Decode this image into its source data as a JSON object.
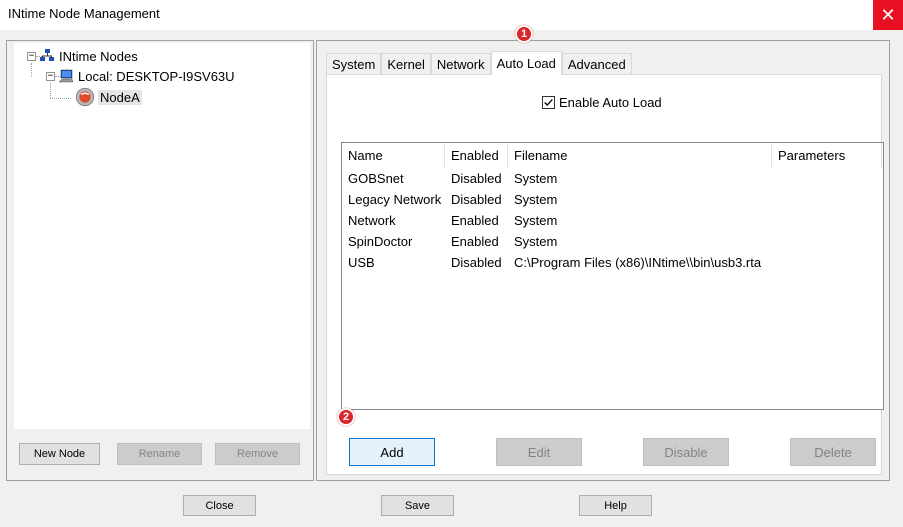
{
  "window": {
    "title": "INtime Node Management",
    "close_glyph": "✕"
  },
  "tree": {
    "root": "INtime Nodes",
    "local": "Local: DESKTOP-I9SV63U",
    "node": "NodeA"
  },
  "left_buttons": {
    "new_node": "New Node",
    "rename": "Rename",
    "remove": "Remove"
  },
  "tabs": [
    "System",
    "Kernel",
    "Network",
    "Auto Load",
    "Advanced"
  ],
  "active_tab": "Auto Load",
  "auto_load": {
    "enable_label": "Enable Auto Load",
    "enabled": true,
    "columns": [
      "Name",
      "Enabled",
      "Filename",
      "Parameters"
    ],
    "rows": [
      {
        "name": "GOBSnet",
        "enabled": "Disabled",
        "filename": "System",
        "parameters": ""
      },
      {
        "name": "Legacy Network",
        "enabled": "Disabled",
        "filename": "System",
        "parameters": ""
      },
      {
        "name": "Network",
        "enabled": "Enabled",
        "filename": "System",
        "parameters": ""
      },
      {
        "name": "SpinDoctor",
        "enabled": "Enabled",
        "filename": "System",
        "parameters": ""
      },
      {
        "name": "USB",
        "enabled": "Disabled",
        "filename": "C:\\Program Files (x86)\\INtime\\\\bin\\usb3.rta",
        "parameters": ""
      }
    ],
    "buttons": {
      "add": "Add",
      "edit": "Edit",
      "disable": "Disable",
      "delete": "Delete"
    }
  },
  "bottom_buttons": {
    "close": "Close",
    "save": "Save",
    "help": "Help"
  },
  "badges": {
    "one": "1",
    "two": "2"
  },
  "colors": {
    "badge": "#d9262b",
    "close_button": "#e81123",
    "focus_border": "#0078d7"
  }
}
